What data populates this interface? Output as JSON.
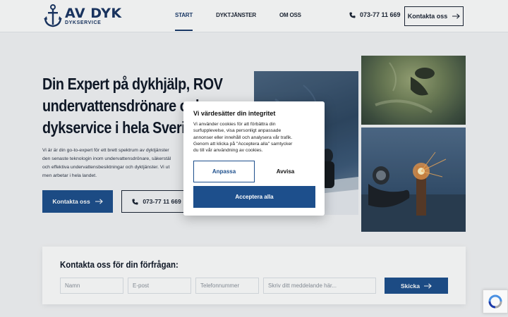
{
  "brand": {
    "name": "AV DYK",
    "subtitle": "DYKSERVICE",
    "colors": {
      "navy": "#1a3563",
      "primary": "#1d4f8c"
    }
  },
  "nav": {
    "items": [
      {
        "label": "START",
        "active": true
      },
      {
        "label": "DYKTJÄNSTER",
        "active": false
      },
      {
        "label": "OM OSS",
        "active": false
      }
    ]
  },
  "header": {
    "phone": "073-77 11 669",
    "contact_label": "Kontakta oss",
    "phone_icon": "phone-icon",
    "arrow_icon": "arrow-right-icon"
  },
  "hero": {
    "title_lines": [
      "Din Expert på dykhjälp, ROV",
      "undervattensdrönare och",
      "dykservice i hela Sverige"
    ],
    "text_lines": [
      "Vi är är din go-to-expert för ett brett spektrum av dyktjänster",
      "den senaste teknologin inom undervattensdrönare, säkerstäl",
      "och effektiva undervattensbesiktningar och dyktjänster. Vi ut",
      "men arbetar i hela landet."
    ],
    "primary_button": "Kontakta oss",
    "phone_button": "073-77 11 669"
  },
  "form": {
    "title": "Kontakta oss för din förfrågan:",
    "name_placeholder": "Namn",
    "email_placeholder": "E-post",
    "phone_placeholder": "Telefonnummer",
    "message_placeholder": "Skriv ditt meddelande här...",
    "submit_label": "Skicka"
  },
  "cookie": {
    "title": "Vi värdesätter din integritet",
    "body_lines": [
      "Vi använder cookies för att förbättra din",
      "surfupplevelse, visa personligt anpassade",
      "annonser eller innehåll och analysera vår trafik.",
      "Genom att klicka på \"Acceptera alla\" samtycker",
      "du till vår användning av cookies."
    ],
    "customize_label": "Anpassa",
    "reject_label": "Avvisa",
    "accept_label": "Acceptera alla"
  }
}
